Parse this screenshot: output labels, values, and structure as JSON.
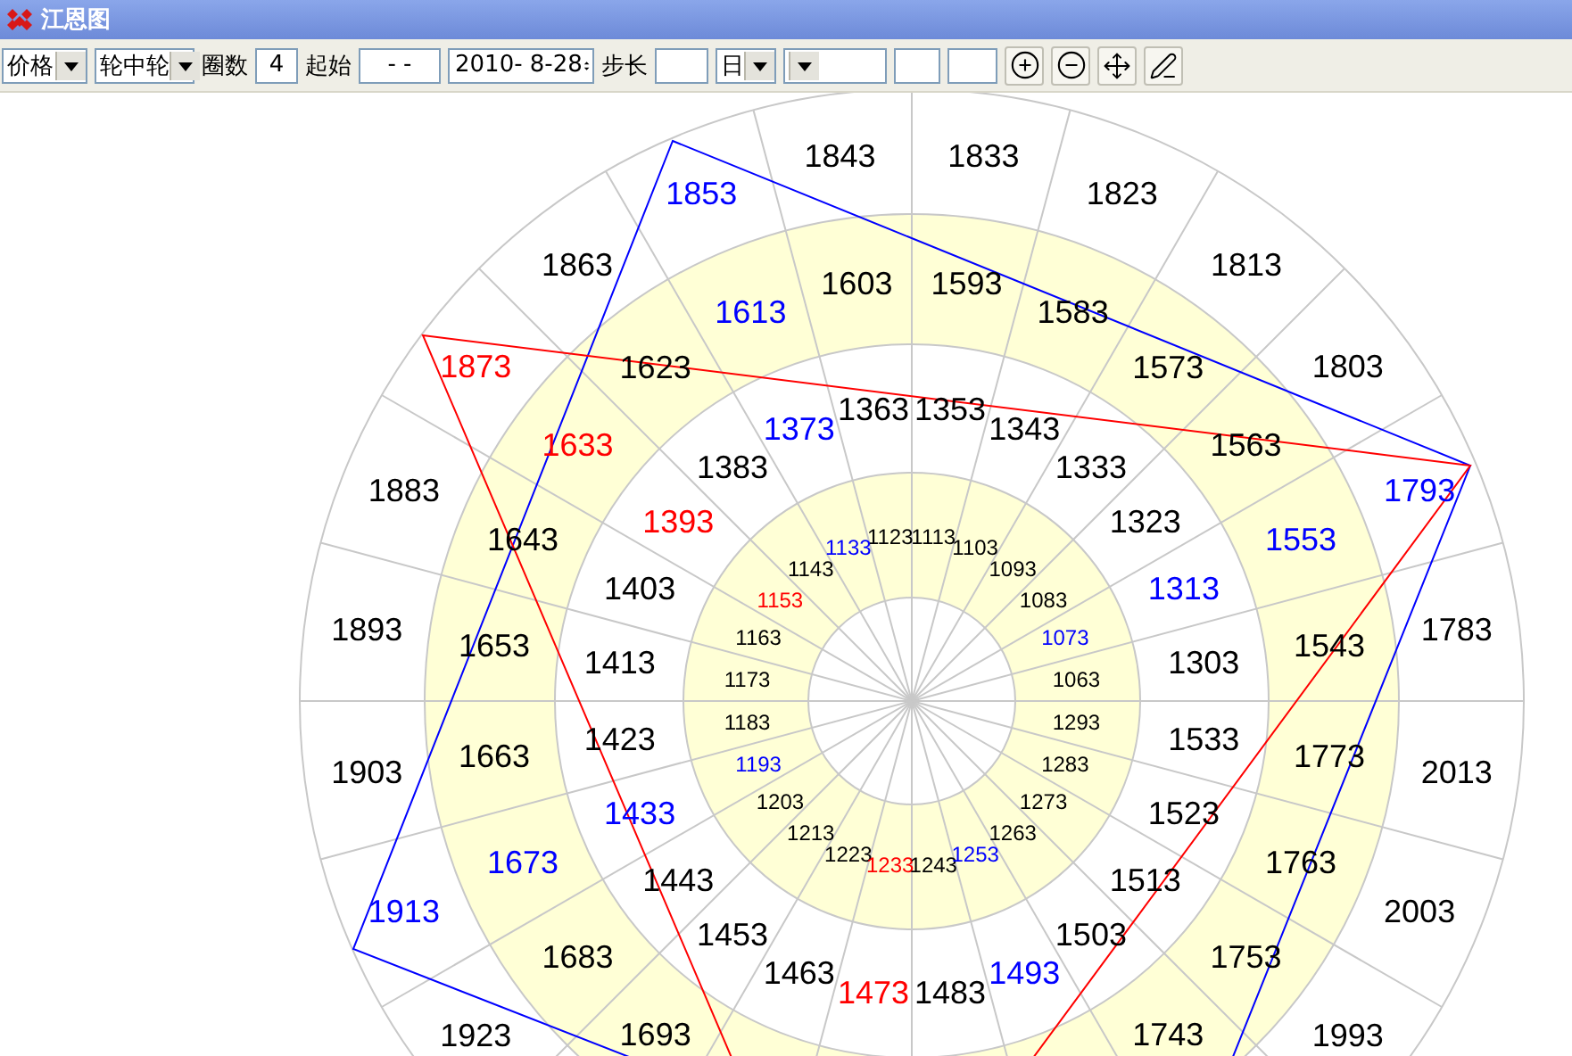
{
  "window": {
    "title": "江恩图"
  },
  "toolbar": [
    {
      "kind": "dropdown",
      "value": "价格"
    },
    {
      "kind": "dropdown",
      "value": "轮中轮"
    },
    {
      "kind": "label",
      "text": "圈数"
    },
    {
      "kind": "input",
      "value": "4"
    },
    {
      "kind": "label",
      "text": "起始"
    },
    {
      "kind": "input",
      "value": "- -"
    },
    {
      "kind": "spinner",
      "value": "2010- 8-28"
    },
    {
      "kind": "label",
      "text": "步长"
    },
    {
      "kind": "input"
    },
    {
      "kind": "dropdown",
      "value": "日"
    },
    {
      "kind": "dropdown"
    },
    {
      "kind": "input"
    },
    {
      "kind": "input"
    }
  ],
  "wheel": {
    "rings": [
      {
        "from_east": [
          {
            "text": "1063",
            "color": "#000000"
          },
          {
            "text": "1073",
            "color": "#0000ff"
          },
          {
            "text": "1083",
            "color": "#000000"
          },
          {
            "text": "1093",
            "color": "#000000"
          },
          {
            "text": "1103",
            "color": "#000000"
          },
          {
            "text": "1113",
            "color": "#000000"
          },
          {
            "text": "1123",
            "color": "#000000"
          },
          {
            "text": "1133",
            "color": "#0000ff"
          },
          {
            "text": "1143",
            "color": "#000000"
          },
          {
            "text": "1153",
            "color": "#ff0000"
          },
          {
            "text": "1163",
            "color": "#000000"
          },
          {
            "text": "1173",
            "color": "#000000"
          },
          {
            "text": "1183",
            "color": "#000000"
          },
          {
            "text": "1193",
            "color": "#0000ff"
          },
          {
            "text": "1203",
            "color": "#000000"
          },
          {
            "text": "1213",
            "color": "#000000"
          },
          {
            "text": "1223",
            "color": "#000000"
          },
          {
            "text": "1233",
            "color": "#ff0000"
          },
          {
            "text": "1243",
            "color": "#000000"
          },
          {
            "text": "1253",
            "color": "#0000ff"
          },
          {
            "text": "1263",
            "color": "#000000"
          },
          {
            "text": "1273",
            "color": "#000000"
          },
          {
            "text": "1283",
            "color": "#000000"
          },
          {
            "text": "1293",
            "color": "#000000"
          }
        ]
      },
      {
        "from_east": [
          {
            "text": "1303",
            "color": "#000000"
          },
          {
            "text": "1313",
            "color": "#0000ff"
          },
          {
            "text": "1323",
            "color": "#000000"
          },
          {
            "text": "1333",
            "color": "#000000"
          },
          {
            "text": "1343",
            "color": "#000000"
          },
          {
            "text": "1353",
            "color": "#000000"
          },
          {
            "text": "1363",
            "color": "#000000"
          },
          {
            "text": "1373",
            "color": "#0000ff"
          },
          {
            "text": "1383",
            "color": "#000000"
          },
          {
            "text": "1393",
            "color": "#ff0000"
          },
          {
            "text": "1403",
            "color": "#000000"
          },
          {
            "text": "1413",
            "color": "#000000"
          },
          {
            "text": "1423",
            "color": "#000000"
          },
          {
            "text": "1433",
            "color": "#0000ff"
          },
          {
            "text": "1443",
            "color": "#000000"
          },
          {
            "text": "1453",
            "color": "#000000"
          },
          {
            "text": "1463",
            "color": "#000000"
          },
          {
            "text": "1473",
            "color": "#ff0000"
          },
          {
            "text": "1483",
            "color": "#000000"
          },
          {
            "text": "1493",
            "color": "#0000ff"
          },
          {
            "text": "1503",
            "color": "#000000"
          },
          {
            "text": "1513",
            "color": "#000000"
          },
          {
            "text": "1523",
            "color": "#000000"
          },
          {
            "text": "1533",
            "color": "#000000"
          }
        ]
      },
      {
        "from_east": [
          {
            "text": "1543",
            "color": "#000000"
          },
          {
            "text": "1553",
            "color": "#0000ff"
          },
          {
            "text": "1563",
            "color": "#000000"
          },
          {
            "text": "1573",
            "color": "#000000"
          },
          {
            "text": "1583",
            "color": "#000000"
          },
          {
            "text": "1593",
            "color": "#000000"
          },
          {
            "text": "1603",
            "color": "#000000"
          },
          {
            "text": "1613",
            "color": "#0000ff"
          },
          {
            "text": "1623",
            "color": "#000000"
          },
          {
            "text": "1633",
            "color": "#ff0000"
          },
          {
            "text": "1643",
            "color": "#000000"
          },
          {
            "text": "1653",
            "color": "#000000"
          },
          {
            "text": "1663",
            "color": "#000000"
          },
          {
            "text": "1673",
            "color": "#0000ff"
          },
          {
            "text": "1683",
            "color": "#000000"
          },
          {
            "text": "1693",
            "color": "#000000"
          }
        ],
        "before_east": [
          {
            "text": "1743",
            "color": "#000000"
          },
          {
            "text": "1753",
            "color": "#000000"
          },
          {
            "text": "1763",
            "color": "#000000"
          },
          {
            "text": "1773",
            "color": "#000000"
          }
        ]
      },
      {
        "from_east": [
          {
            "text": "1783",
            "color": "#000000"
          },
          {
            "text": "1793",
            "color": "#0000ff"
          },
          {
            "text": "1803",
            "color": "#000000"
          },
          {
            "text": "1813",
            "color": "#000000"
          },
          {
            "text": "1823",
            "color": "#000000"
          },
          {
            "text": "1833",
            "color": "#000000"
          },
          {
            "text": "1843",
            "color": "#000000"
          },
          {
            "text": "1853",
            "color": "#0000ff"
          },
          {
            "text": "1863",
            "color": "#000000"
          },
          {
            "text": "1873",
            "color": "#ff0000"
          },
          {
            "text": "1883",
            "color": "#000000"
          },
          {
            "text": "1893",
            "color": "#000000"
          },
          {
            "text": "1903",
            "color": "#000000"
          },
          {
            "text": "1913",
            "color": "#0000ff"
          },
          {
            "text": "1923",
            "color": "#000000"
          }
        ],
        "before_east": [
          {
            "text": "1993",
            "color": "#000000"
          },
          {
            "text": "2003",
            "color": "#000000"
          },
          {
            "text": "2013",
            "color": "#000000"
          }
        ]
      }
    ]
  }
}
